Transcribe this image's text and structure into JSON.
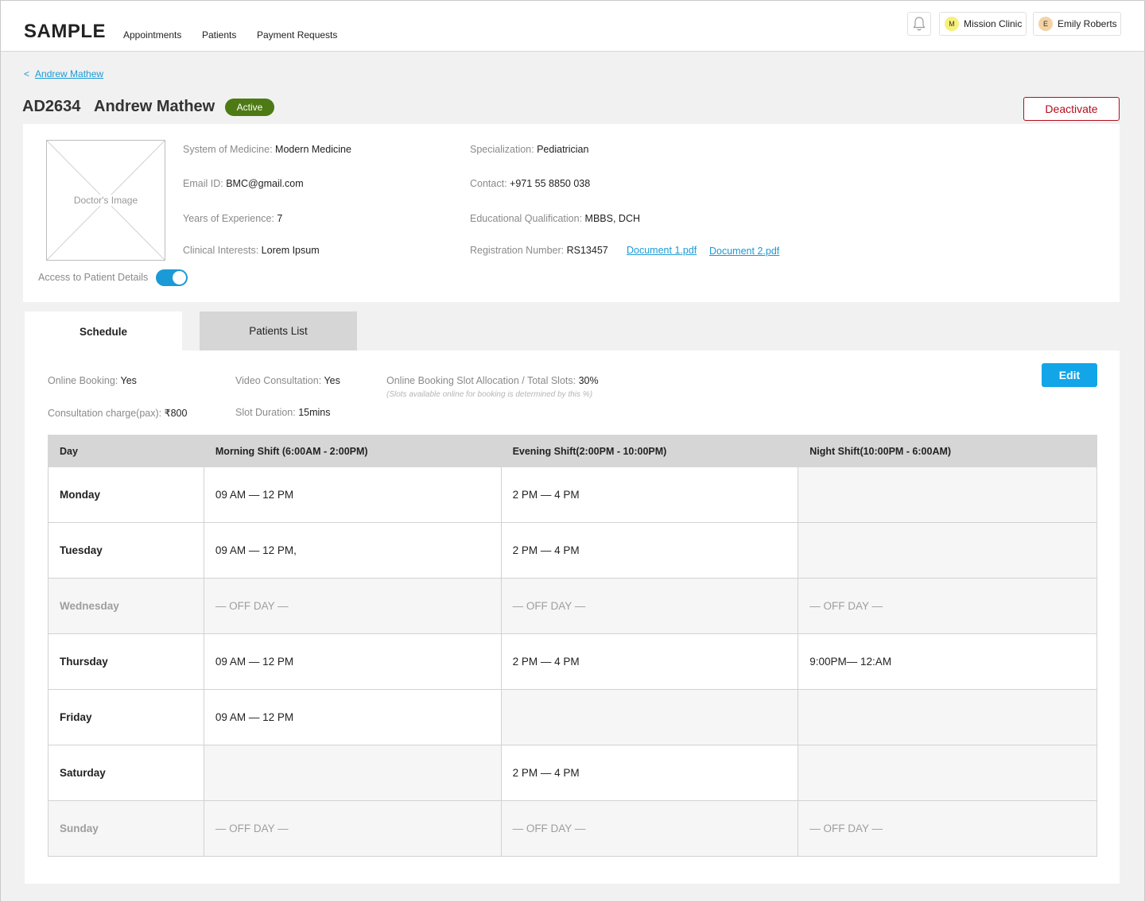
{
  "app": {
    "logo": "SAMPLE"
  },
  "nav": {
    "items": [
      "Appointments",
      "Patients",
      "Payment Requests"
    ]
  },
  "header": {
    "clinic": {
      "initial": "M",
      "name": "Mission Clinic",
      "color": "#f5f07a"
    },
    "user": {
      "initial": "E",
      "name": "Emily Roberts",
      "color": "#f3d3a4"
    }
  },
  "breadcrumb": {
    "back": "<",
    "label": "Andrew Mathew"
  },
  "doctor": {
    "id": "AD2634",
    "name": "Andrew Mathew",
    "status": "Active",
    "status_color": "#4d7a14",
    "deactivate_label": "Deactivate",
    "image_label": "Doctor's Image",
    "system_label": "System of Medicine:",
    "system": "Modern Medicine",
    "specialization_label": "Specialization:",
    "specialization": "Pediatrician",
    "email_label": "Email ID:",
    "email": "BMC@gmail.com",
    "contact_label": "Contact:",
    "contact": "+971 55 8850 038",
    "experience_label": "Years of Experience:",
    "experience": "7",
    "qualification_label": "Educational Qualification:",
    "qualification": "MBBS, DCH",
    "interests_label": "Clinical Interests:",
    "interests": "Lorem Ipsum",
    "registration_label": "Registration Number:",
    "registration": "RS13457",
    "documents": [
      "Document 1.pdf",
      "Document 2.pdf"
    ],
    "access_label": "Access to Patient Details",
    "access_enabled": true
  },
  "tabs": [
    "Schedule",
    "Patients List"
  ],
  "schedule": {
    "online_booking_label": "Online Booking:",
    "online_booking": "Yes",
    "video_label": "Video Consultation:",
    "video": "Yes",
    "slot_alloc_label": "Online Booking Slot Allocation / Total Slots:",
    "slot_alloc": "30%",
    "slot_note": "(Slots available online for booking is determined by this %)",
    "charge_label": "Consultation charge(pax):",
    "charge": "₹800",
    "duration_label": "Slot Duration:",
    "duration": "15mins",
    "edit_label": "Edit",
    "columns": [
      "Day",
      "Morning Shift (6:00AM - 2:00PM)",
      "Evening Shift(2:00PM - 10:00PM)",
      "Night Shift(10:00PM - 6:00AM)"
    ],
    "rows": [
      {
        "day": "Monday",
        "morning": "09 AM — 12 PM",
        "evening": "2 PM — 4 PM",
        "night": "",
        "off": false
      },
      {
        "day": "Tuesday",
        "morning": "09 AM — 12 PM,",
        "evening": "2 PM — 4 PM",
        "night": "",
        "off": false
      },
      {
        "day": "Wednesday",
        "morning": "— OFF DAY —",
        "evening": "— OFF DAY —",
        "night": "— OFF DAY —",
        "off": true
      },
      {
        "day": "Thursday",
        "morning": "09 AM — 12 PM",
        "evening": "2 PM — 4 PM",
        "night": "9:00PM— 12:AM",
        "off": false
      },
      {
        "day": "Friday",
        "morning": "09 AM — 12 PM",
        "evening": "",
        "night": "",
        "off": false
      },
      {
        "day": "Saturday",
        "morning": "",
        "evening": "2 PM — 4 PM",
        "night": "",
        "off": false
      },
      {
        "day": "Sunday",
        "morning": "— OFF DAY —",
        "evening": "— OFF DAY —",
        "night": "— OFF DAY —",
        "off": true
      }
    ]
  }
}
